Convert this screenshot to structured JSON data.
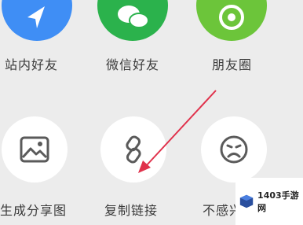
{
  "share_targets": {
    "site_friends": {
      "label": "站内好友",
      "icon": "paper-plane-icon",
      "color": "#3f8ef5"
    },
    "wechat_friends": {
      "label": "微信好友",
      "icon": "wechat-icon",
      "color": "#2bb24c"
    },
    "moments": {
      "label": "朋友圈",
      "icon": "camera-shutter-icon",
      "color": "#6cc53a"
    },
    "generate_image": {
      "label": "生成分享图",
      "icon": "image-icon"
    },
    "copy_link": {
      "label": "复制链接",
      "icon": "link-icon"
    },
    "not_interested": {
      "label": "不感兴",
      "icon": "sad-face-icon"
    }
  },
  "annotation": {
    "color": "#e0314b"
  },
  "watermark": {
    "text": "1403手游网"
  }
}
